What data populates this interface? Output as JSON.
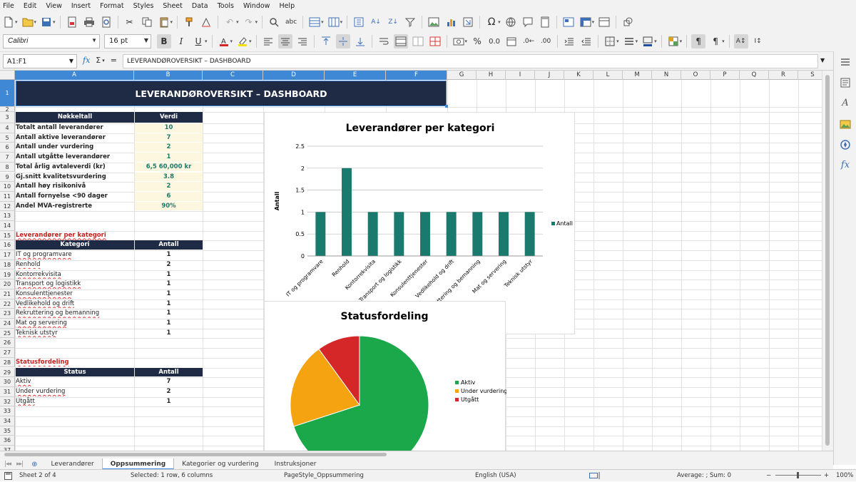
{
  "menu": [
    "File",
    "Edit",
    "View",
    "Insert",
    "Format",
    "Styles",
    "Sheet",
    "Data",
    "Tools",
    "Window",
    "Help"
  ],
  "font": {
    "name": "Calibri",
    "size": "16 pt"
  },
  "formula": {
    "cell_ref": "A1:F1",
    "content": "LEVERANDØROVERSIKT – DASHBOARD",
    "fx": "fx",
    "sigma": "Σ",
    "equals": "="
  },
  "columns": [
    "A",
    "B",
    "C",
    "D",
    "E",
    "F",
    "G",
    "H",
    "I",
    "J",
    "K",
    "L",
    "M",
    "N",
    "O",
    "P",
    "Q",
    "R",
    "S"
  ],
  "rows": [
    "1",
    "2",
    "3",
    "4",
    "5",
    "6",
    "7",
    "8",
    "9",
    "10",
    "11",
    "12",
    "13",
    "14",
    "15",
    "16",
    "17",
    "18",
    "19",
    "20",
    "21",
    "22",
    "23",
    "24",
    "25",
    "26",
    "27",
    "28",
    "29",
    "30",
    "31",
    "32",
    "33",
    "34",
    "35",
    "36",
    "37"
  ],
  "title": "LEVERANDØROVERSIKT – DASHBOARD",
  "kpi": {
    "header_label": "Nøkkeltall",
    "header_value": "Verdi",
    "rows": [
      {
        "label": "Totalt antall leverandører",
        "value": "10"
      },
      {
        "label": "Antall aktive leverandører",
        "value": "7"
      },
      {
        "label": "Antall under vurdering",
        "value": "2"
      },
      {
        "label": "Antall utgåtte leverandører",
        "value": "1"
      },
      {
        "label": "Total årlig avtaleverdi (kr)",
        "value": "6,5 60,000 kr"
      },
      {
        "label": "Gj.snitt kvalitetsvurdering",
        "value": "3.8"
      },
      {
        "label": "Antall høy risikonivå",
        "value": "2"
      },
      {
        "label": "Antall fornyelse <90 dager",
        "value": "6"
      },
      {
        "label": "Andel MVA-registrerte",
        "value": "90%"
      }
    ]
  },
  "category_section": {
    "title": "Leverandører per kategori",
    "header_label": "Kategori",
    "header_value": "Antall",
    "rows": [
      {
        "label": "IT og programvare",
        "value": "1"
      },
      {
        "label": "Renhold",
        "value": "2"
      },
      {
        "label": "Kontorrekvisita",
        "value": "1"
      },
      {
        "label": "Transport og logistikk",
        "value": "1"
      },
      {
        "label": "Konsulenttjenester",
        "value": "1"
      },
      {
        "label": "Vedlikehold og drift",
        "value": "1"
      },
      {
        "label": "Rekruttering og bemanning",
        "value": "1"
      },
      {
        "label": "Mat og servering",
        "value": "1"
      },
      {
        "label": "Teknisk utstyr",
        "value": "1"
      }
    ]
  },
  "status_section": {
    "title": "Statusfordeling",
    "header_label": "Status",
    "header_value": "Antall",
    "rows": [
      {
        "label": "Aktiv",
        "value": "7"
      },
      {
        "label": "Under vurdering",
        "value": "2"
      },
      {
        "label": "Utgått",
        "value": "1"
      }
    ]
  },
  "chart_data": [
    {
      "type": "bar",
      "title": "Leverandører per kategori",
      "xlabel": "",
      "ylabel": "Antall",
      "ylim": [
        0,
        2.5
      ],
      "yticks": [
        "0",
        "0.5",
        "1",
        "1.5",
        "2",
        "2.5"
      ],
      "categories": [
        "IT og programvare",
        "Renhold",
        "Kontorrekvisita",
        "Transport og logistikk",
        "Konsulenttjenester",
        "Vedlikehold og drift",
        "Rekruttering og bemanning",
        "Mat og servering",
        "Teknisk utstyr"
      ],
      "series": [
        {
          "name": "Antall",
          "values": [
            1,
            2,
            1,
            1,
            1,
            1,
            1,
            1,
            1
          ],
          "color": "#1a7a6e"
        }
      ],
      "grid": true,
      "legend": "right"
    },
    {
      "type": "pie",
      "title": "Statusfordeling",
      "categories": [
        "Aktiv",
        "Under vurdering",
        "Utgått"
      ],
      "values": [
        7,
        2,
        1
      ],
      "colors": [
        "#1aa84a",
        "#f5a310",
        "#d62728"
      ],
      "legend": "right"
    }
  ],
  "sheet_tabs": [
    "Leverandører",
    "Oppsummering",
    "Kategorier og vurdering",
    "Instruksjoner"
  ],
  "active_tab": "Oppsummering",
  "status": {
    "sheet": "Sheet 2 of 4",
    "selection": "Selected: 1 row, 6 columns",
    "page_style": "PageStyle_Oppsummering",
    "language": "English (USA)",
    "sum": "Average: ; Sum: 0",
    "zoom": "100%"
  }
}
